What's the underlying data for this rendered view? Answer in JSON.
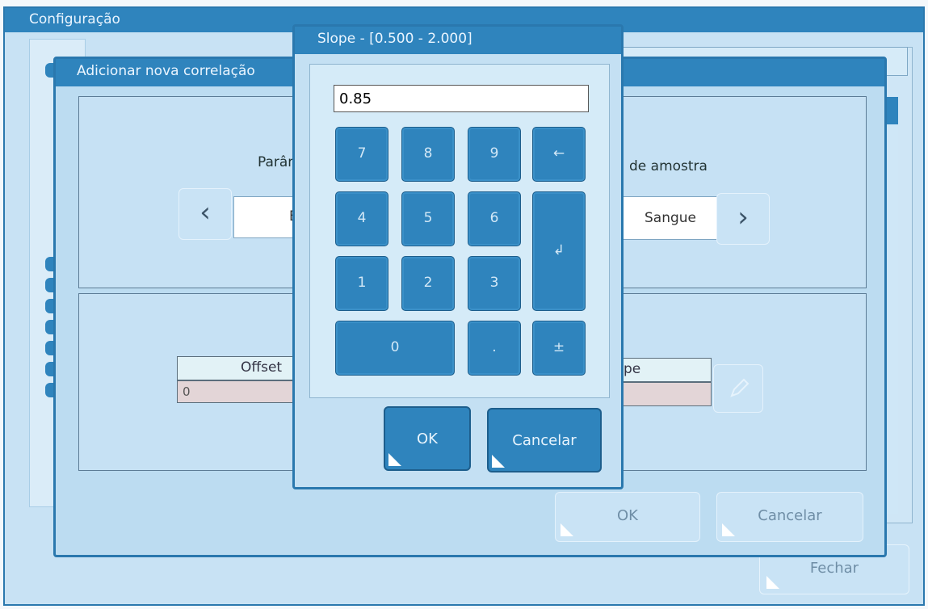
{
  "config_window": {
    "title": "Configuração",
    "close_label": "Fechar"
  },
  "add_window": {
    "title": "Adicionar nova correlação",
    "param_label": "Parâm",
    "param_value": "Bi",
    "sample_type_label": "de amostra",
    "sample_value": "Sangue",
    "prev_icon": "‹",
    "next_icon": "›",
    "offset_header": "Offset",
    "offset_value": "0",
    "slope_header": "pe",
    "ok_label": "OK",
    "cancel_label": "Cancelar"
  },
  "slope_dialog": {
    "title": "Slope - [0.500 - 2.000]",
    "input_value": "0.85",
    "keys": {
      "k7": "7",
      "k8": "8",
      "k9": "9",
      "backspace": "←",
      "k4": "4",
      "k5": "5",
      "k6": "6",
      "enter": "↲",
      "k1": "1",
      "k2": "2",
      "k3": "3",
      "k0": "0",
      "dot": ".",
      "plusminus": "±"
    },
    "ok_label": "OK",
    "cancel_label": "Cancelar"
  }
}
